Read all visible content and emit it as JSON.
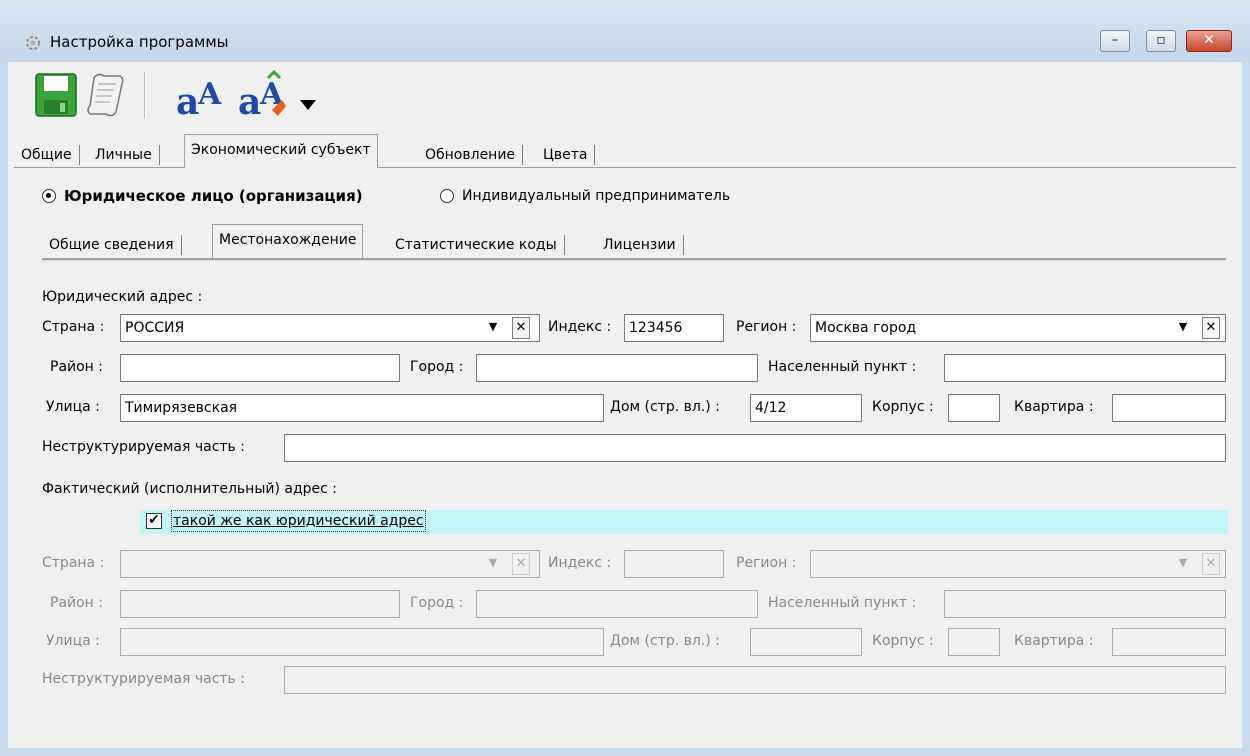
{
  "window": {
    "title": "Настройка программы",
    "close_glyph": "✕",
    "min_glyph": "–",
    "max_glyph": "▫"
  },
  "toolbar": {
    "icons": [
      "save-icon",
      "script-icon",
      "font-icon",
      "font-color-icon",
      "dropdown-arrow-icon"
    ]
  },
  "tabs": [
    "Общие",
    "Личные",
    "Экономический субъект",
    "Обновление",
    "Цвета"
  ],
  "entity_type": {
    "legal": "Юридическое лицо (организация)",
    "individual": "Индивидуальный предприниматель",
    "selected": "legal"
  },
  "subtabs": [
    "Общие сведения",
    "Местонахождение",
    "Статистические коды",
    "Лицензии"
  ],
  "legal_address": {
    "section_label": "Юридический адрес :",
    "country_label": "Страна :",
    "country": "РОССИЯ",
    "index_label": "Индекс :",
    "index": "123456",
    "region_label": "Регион :",
    "region": "Москва город",
    "district_label": "Район :",
    "district": "",
    "city_label": "Город :",
    "city": "",
    "locality_label": "Населенный пункт :",
    "locality": "",
    "street_label": "Улица :",
    "street": "Тимирязевская",
    "house_label": "Дом (стр. вл.) :",
    "house": "4/12",
    "building_label": "Корпус :",
    "building": "",
    "apartment_label": "Квартира :",
    "apartment": "",
    "unstructured_label": "Неструктурируемая часть :",
    "unstructured": ""
  },
  "actual_address": {
    "section_label": "Фактический (исполнительный) адрес :",
    "same_as_legal_label": "такой же как юридический адрес",
    "same_as_legal_checked": "✔",
    "country_label": "Страна :",
    "index_label": "Индекс :",
    "region_label": "Регион :",
    "district_label": "Район :",
    "city_label": "Город :",
    "locality_label": "Населенный пункт :",
    "street_label": "Улица :",
    "house_label": "Дом (стр. вл.) :",
    "building_label": "Корпус :",
    "apartment_label": "Квартира :",
    "unstructured_label": "Неструктурируемая часть :"
  },
  "combo": {
    "arrow": "▼",
    "clear": "✕"
  },
  "colors": {
    "highlight_row": "#c4f5f8",
    "title_bar": "#c4d7ee"
  }
}
